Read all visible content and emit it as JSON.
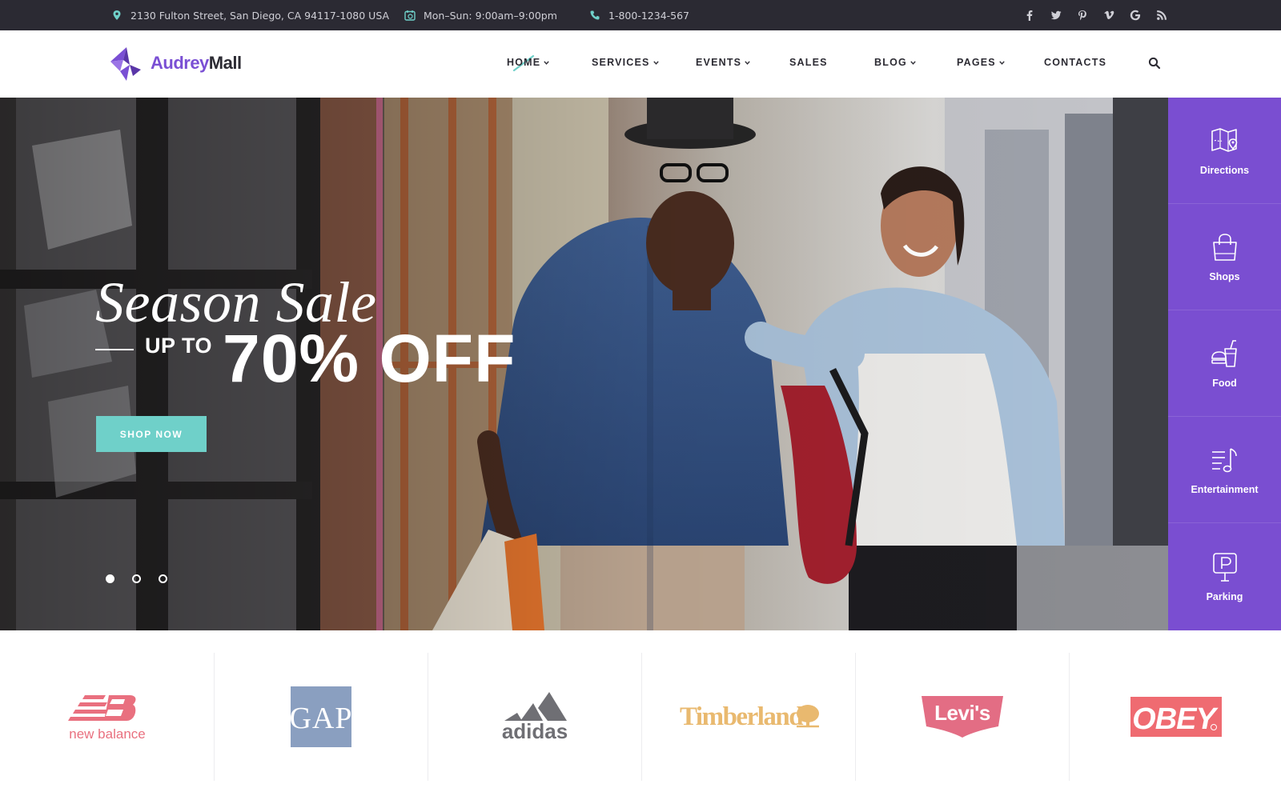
{
  "topbar": {
    "address": "2130 Fulton Street, San Diego, CA 94117-1080 USA",
    "hours": "Mon–Sun: 9:00am–9:00pm",
    "phone": "1-800-1234-567",
    "socials": [
      "facebook-icon",
      "twitter-icon",
      "pinterest-icon",
      "vimeo-icon",
      "google-icon",
      "rss-icon"
    ]
  },
  "header": {
    "brand_first": "Audrey",
    "brand_second": "Mall",
    "nav": {
      "home": "HOME",
      "services": "SERVICES",
      "events": "EVENTS",
      "sales": "SALES",
      "blog": "BLOG",
      "pages": "PAGES",
      "contacts": "CONTACTS"
    }
  },
  "hero": {
    "title": "Season Sale",
    "up_to": "UP TO",
    "discount": "70% OFF",
    "cta": "SHOP NOW",
    "slides": 3,
    "active_slide": 1
  },
  "quick_links": {
    "directions": "Directions",
    "shops": "Shops",
    "food": "Food",
    "entertainment": "Entertainment",
    "parking": "Parking"
  },
  "brands": {
    "new_balance": "new balance",
    "gap": "GAP",
    "adidas": "adidas",
    "timberland": "Timberland",
    "levis": "Levi's",
    "obey": "OBEY"
  },
  "colors": {
    "accent_purple": "#7a4ed1",
    "accent_teal": "#6fd0c9",
    "topbar_bg": "#2b2a33",
    "text_dark": "#2c2b33"
  }
}
